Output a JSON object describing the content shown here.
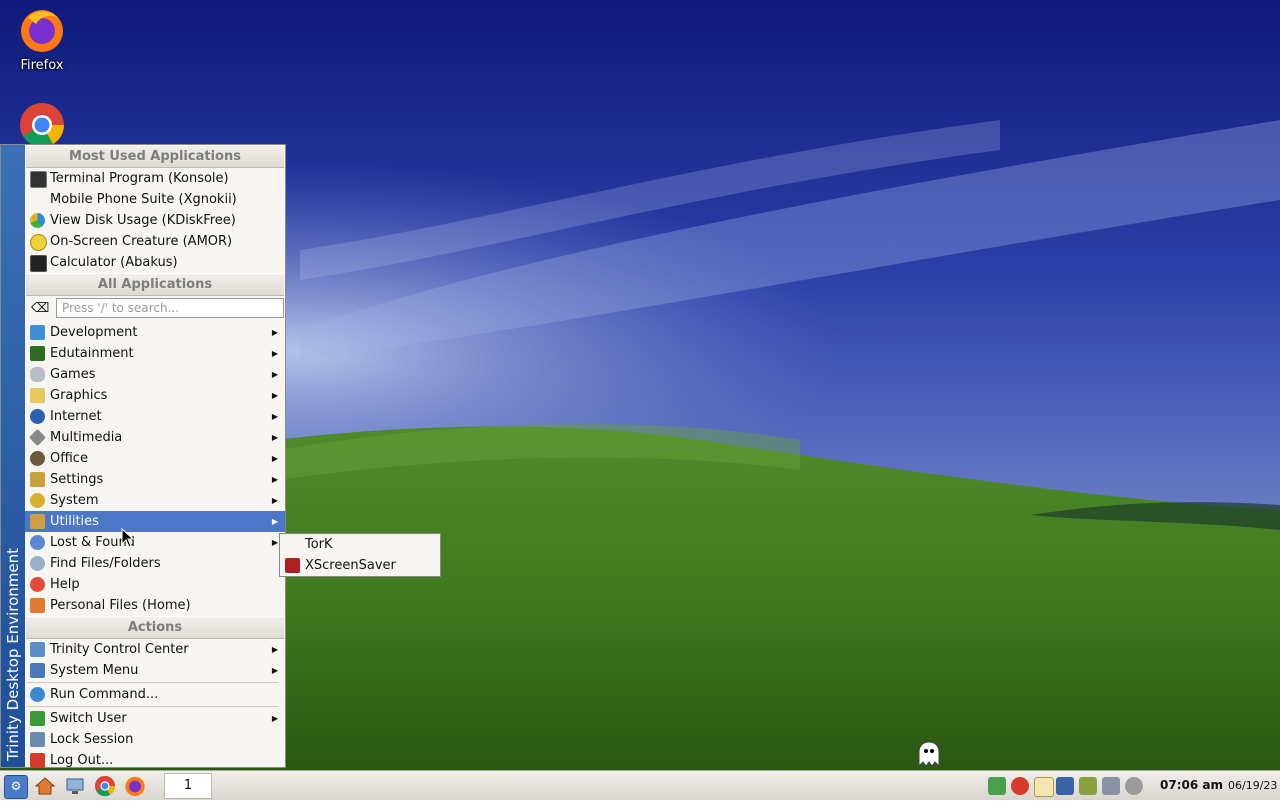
{
  "desktop": {
    "icons": [
      {
        "label": "Firefox",
        "icon": "firefox-icon"
      },
      {
        "label": "",
        "icon": "chrome-icon"
      }
    ]
  },
  "kmenu": {
    "sidebar_text": "Trinity Desktop Environment",
    "sections": {
      "most_used": "Most Used Applications",
      "all_apps": "All Applications",
      "actions": "Actions"
    },
    "most_used": [
      {
        "label": "Terminal Program (Konsole)",
        "icon": "terminal-icon"
      },
      {
        "label": "Mobile Phone Suite (Xgnokii)",
        "icon": ""
      },
      {
        "label": "View Disk Usage (KDiskFree)",
        "icon": "disk-usage-icon"
      },
      {
        "label": "On-Screen Creature (AMOR)",
        "icon": "creature-icon"
      },
      {
        "label": "Calculator (Abakus)",
        "icon": "calculator-icon"
      }
    ],
    "search": {
      "placeholder": "Press '/' to search..."
    },
    "categories": [
      {
        "label": "Development",
        "icon": "development-icon",
        "submenu": true
      },
      {
        "label": "Edutainment",
        "icon": "edutainment-icon",
        "submenu": true
      },
      {
        "label": "Games",
        "icon": "games-icon",
        "submenu": true
      },
      {
        "label": "Graphics",
        "icon": "graphics-icon",
        "submenu": true
      },
      {
        "label": "Internet",
        "icon": "internet-icon",
        "submenu": true
      },
      {
        "label": "Multimedia",
        "icon": "multimedia-icon",
        "submenu": true
      },
      {
        "label": "Office",
        "icon": "office-icon",
        "submenu": true
      },
      {
        "label": "Settings",
        "icon": "settings-icon",
        "submenu": true
      },
      {
        "label": "System",
        "icon": "system-icon",
        "submenu": true
      },
      {
        "label": "Utilities",
        "icon": "utilities-icon",
        "submenu": true,
        "highlighted": true
      },
      {
        "label": "Lost & Found",
        "icon": "lost-found-icon",
        "submenu": true
      },
      {
        "label": "Find Files/Folders",
        "icon": "find-files-icon",
        "submenu": false
      },
      {
        "label": "Help",
        "icon": "help-icon",
        "submenu": false
      },
      {
        "label": "Personal Files (Home)",
        "icon": "home-icon",
        "submenu": false
      }
    ],
    "actions": [
      {
        "label": "Trinity Control Center",
        "icon": "control-center-icon",
        "submenu": true
      },
      {
        "label": "System Menu",
        "icon": "system-menu-icon",
        "submenu": true
      },
      {
        "label": "Run Command...",
        "icon": "run-command-icon",
        "submenu": false
      },
      {
        "label": "Switch User",
        "icon": "switch-user-icon",
        "submenu": true
      },
      {
        "label": "Lock Session",
        "icon": "lock-session-icon",
        "submenu": false
      },
      {
        "label": "Log Out...",
        "icon": "logout-icon",
        "submenu": false
      }
    ]
  },
  "utilities_submenu": [
    {
      "label": "TorK",
      "icon": ""
    },
    {
      "label": "XScreenSaver",
      "icon": "xscreensaver-icon"
    }
  ],
  "taskbar": {
    "launchers": [
      "kmenu-icon",
      "home-icon",
      "network-icon",
      "chrome-icon",
      "firefox-icon"
    ],
    "pager_desktop": "1",
    "tray": [
      "network-tray-icon",
      "updates-tray-icon",
      "klipper-tray-icon",
      "display-tray-icon",
      "tools-tray-icon",
      "printer-tray-icon",
      "globe-tray-icon"
    ],
    "clock_time": "07:06 am",
    "clock_date": "06/19/23"
  },
  "colors": {
    "highlight": "#4b77c8",
    "sidebar": "#2a5ca8",
    "menu_bg": "#f7f5f1"
  }
}
